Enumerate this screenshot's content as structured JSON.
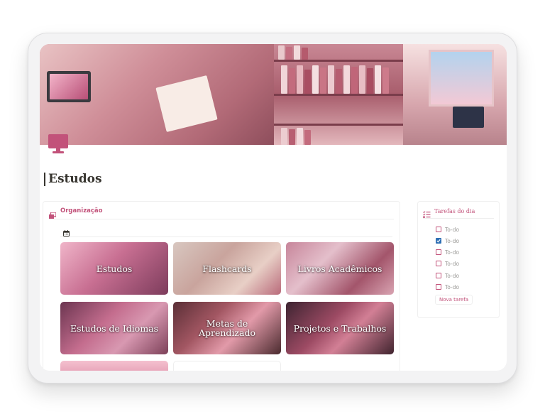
{
  "page": {
    "title": "Estudos",
    "icon": "monitor-icon"
  },
  "organization": {
    "title": "Organização",
    "icon": "stack-icon",
    "view_icon": "calendar-icon",
    "cards": [
      {
        "label": "Estudos"
      },
      {
        "label": "Flashcards"
      },
      {
        "label": "Livros Acadêmicos"
      },
      {
        "label": "Estudos de Idiomas"
      },
      {
        "label": "Metas de Aprendizado"
      },
      {
        "label": "Projetos e Trabalhos"
      }
    ]
  },
  "tasks": {
    "title": "Tarefas do dia",
    "icon": "checklist-icon",
    "items": [
      {
        "label": "To-do",
        "checked": false
      },
      {
        "label": "To-do",
        "checked": true
      },
      {
        "label": "To-do",
        "checked": false
      },
      {
        "label": "To-do",
        "checked": false
      },
      {
        "label": "To-do",
        "checked": false
      },
      {
        "label": "To-do",
        "checked": false
      }
    ],
    "new_task_label": "Nova tarefa"
  },
  "colors": {
    "accent": "#c2527a",
    "checkbox_checked": "#2e6fb4"
  }
}
